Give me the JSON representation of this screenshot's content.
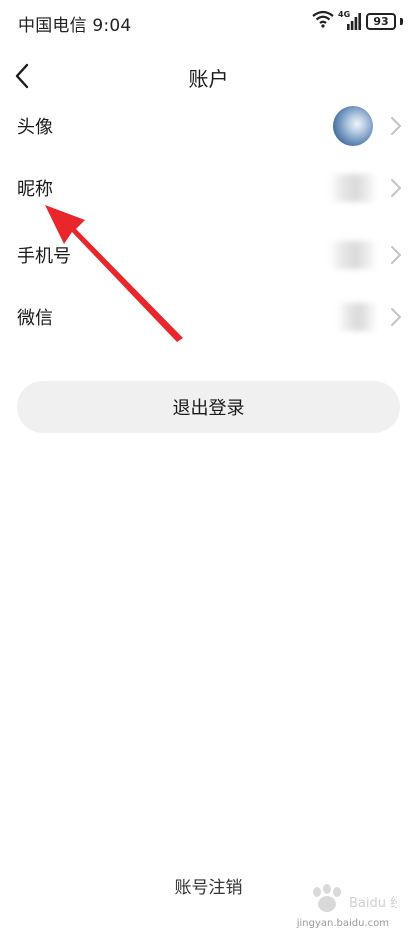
{
  "status_bar": {
    "carrier_time": "中国电信 9:04",
    "network": "4G",
    "battery": "93"
  },
  "nav": {
    "title": "账户"
  },
  "rows": [
    {
      "label": "头像"
    },
    {
      "label": "昵称"
    },
    {
      "label": "手机号"
    },
    {
      "label": "微信"
    }
  ],
  "logout_label": "退出登录",
  "cancel_account_label": "账号注销",
  "watermark": {
    "logo_text": "Baidu 经验",
    "url": "jingyan.baidu.com"
  },
  "colors": {
    "annotation_arrow": "#e8262b",
    "button_bg": "#f0f0f0"
  }
}
